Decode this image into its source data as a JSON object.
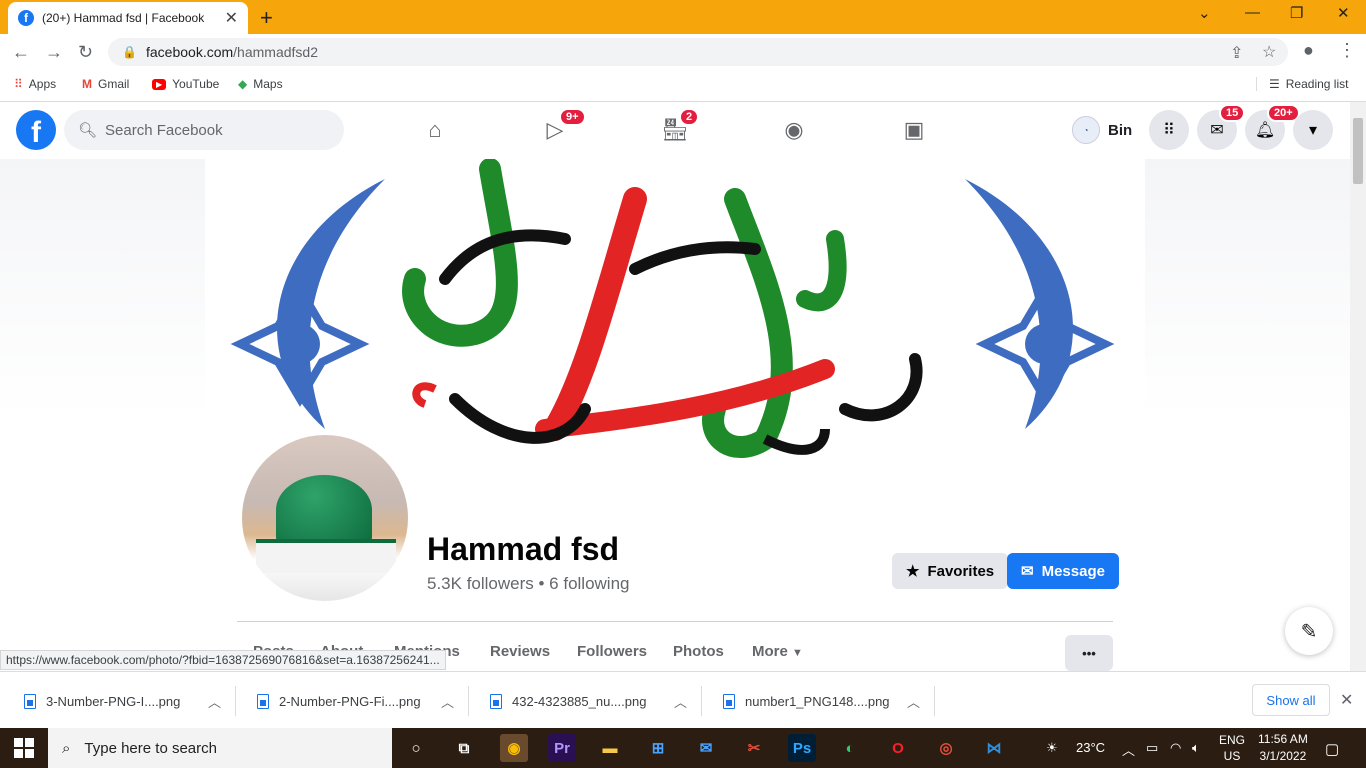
{
  "browser": {
    "tab_title": "(20+) Hammad fsd | Facebook",
    "url_host": "facebook.com",
    "url_path": "/hammadfsd2",
    "bookmarks": [
      "Apps",
      "Gmail",
      "YouTube",
      "Maps"
    ],
    "reading_list": "Reading list",
    "status_url": "https://www.facebook.com/photo/?fbid=163872569076816&set=a.16387256241..."
  },
  "fb": {
    "search_placeholder": "Search Facebook",
    "watch_badge": "9+",
    "marketplace_badge": "2",
    "profile_name": "Bin",
    "messenger_badge": "15",
    "notif_badge": "20+"
  },
  "profile": {
    "name": "Hammad fsd",
    "stats": "5.3K followers • 6 following",
    "favorites_label": "Favorites",
    "message_label": "Message",
    "tabs": [
      "Posts",
      "About",
      "Mentions",
      "Reviews",
      "Followers",
      "Photos",
      "More"
    ],
    "more_dots": "•••"
  },
  "downloads": {
    "items": [
      "3-Number-PNG-I....png",
      "2-Number-PNG-Fi....png",
      "432-4323885_nu....png",
      "number1_PNG148....png"
    ],
    "show_all": "Show all"
  },
  "taskbar": {
    "search_placeholder": "Type here to search",
    "weather": "23°C",
    "lang1": "ENG",
    "lang2": "US",
    "time": "11:56 AM",
    "date": "3/1/2022"
  },
  "colors": {
    "tabbar": "#f6a50a",
    "fb_blue": "#1877f2",
    "badge_red": "#e41e3f"
  }
}
